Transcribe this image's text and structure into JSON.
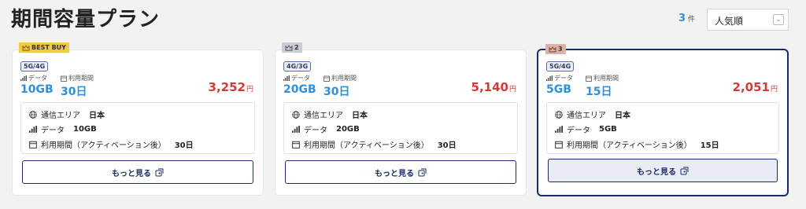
{
  "page": {
    "title": "期間容量プラン"
  },
  "toolbar": {
    "count": "3",
    "count_unit": "件",
    "sort_value": "人気順"
  },
  "labels": {
    "data": "データ",
    "period": "利用期間",
    "area_label": "通信エリア",
    "data_label": "データ",
    "period_label": "利用期間（アクティベーション後）",
    "more": "もっと見る",
    "yen": "円"
  },
  "colors": {
    "accent": "#2f8fd8",
    "price": "#d23a3a",
    "navy": "#1a2b6b",
    "best_buy_tag": "#f2c94c"
  },
  "cards": [
    {
      "rank": "BEST BUY",
      "network": "5G/4G",
      "data": "10GB",
      "period": "30日",
      "price": "3,252",
      "area": "日本",
      "data_detail": "10GB",
      "period_detail": "30日"
    },
    {
      "rank": "2",
      "network": "4G/3G",
      "data": "20GB",
      "period": "30日",
      "price": "5,140",
      "area": "日本",
      "data_detail": "20GB",
      "period_detail": "30日"
    },
    {
      "rank": "3",
      "network": "5G/4G",
      "data": "5GB",
      "period": "15日",
      "price": "2,051",
      "area": "日本",
      "data_detail": "5GB",
      "period_detail": "15日"
    }
  ]
}
